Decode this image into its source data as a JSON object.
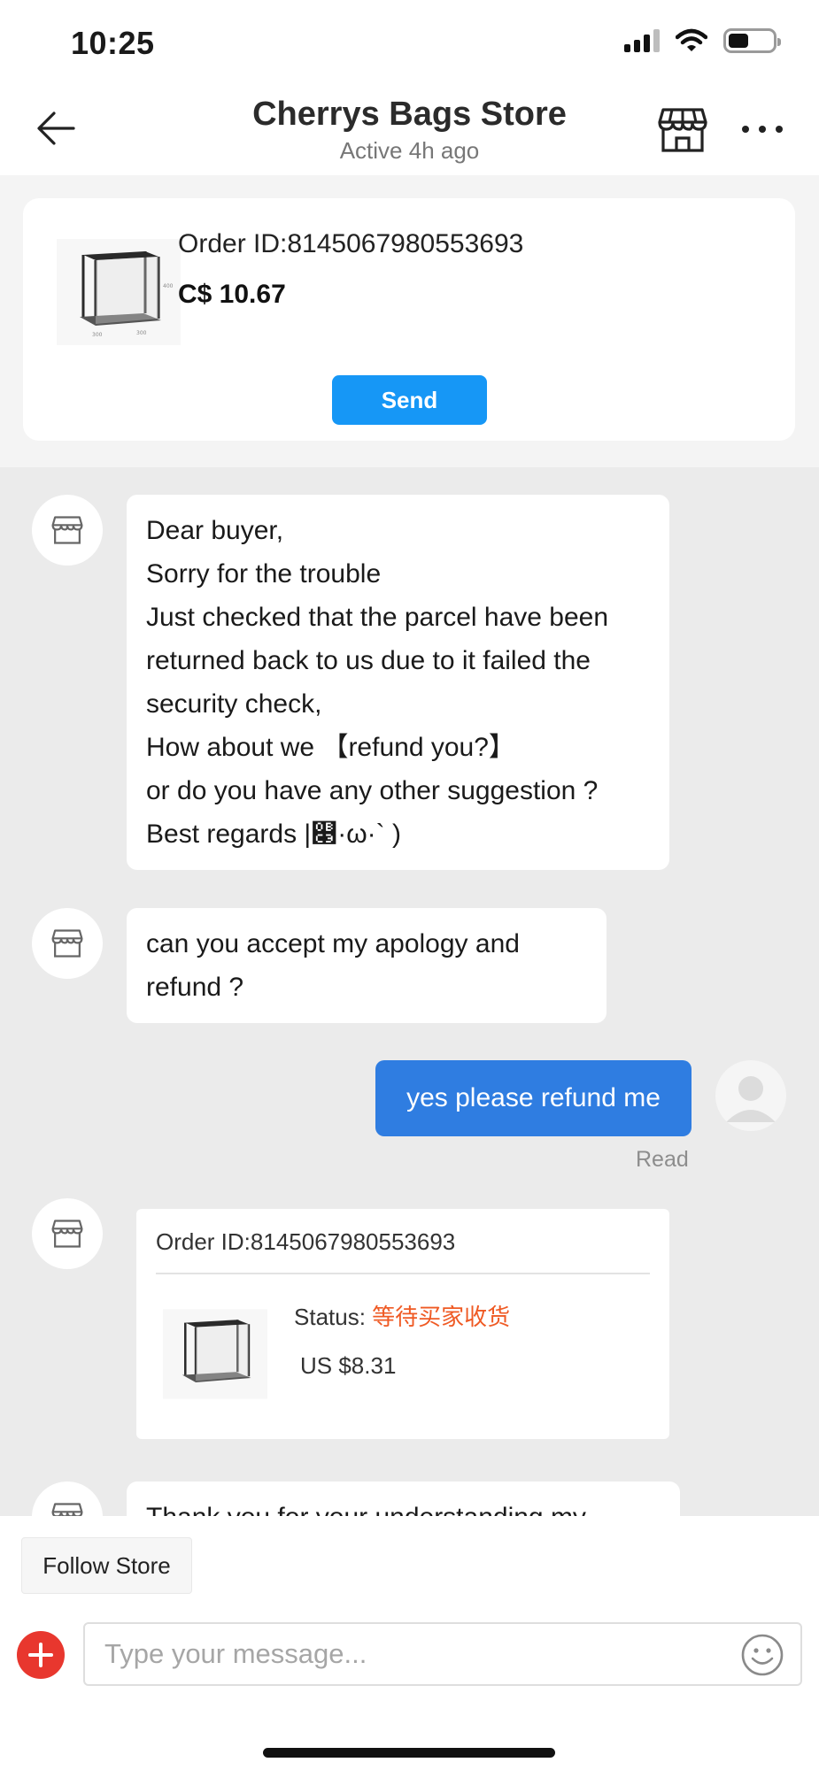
{
  "status_bar": {
    "time": "10:25",
    "signal_icon": "signal-icon",
    "wifi_icon": "wifi-icon",
    "battery_icon": "battery-icon"
  },
  "header": {
    "store_name": "Cherrys Bags Store",
    "active_status": "Active 4h ago",
    "back_icon": "arrow-left-icon",
    "store_icon": "storefront-icon",
    "more_icon": "more-dots-icon"
  },
  "order_card": {
    "order_id": "Order ID:8145067980553693",
    "price": "C$ 10.67",
    "send_label": "Send"
  },
  "messages": {
    "m1_lines": [
      "Dear buyer,",
      "Sorry for the trouble",
      "Just checked that the parcel have been",
      "returned back to us due to it failed the",
      "security check,",
      "How about we 【refund you?】",
      "or do you have any other suggestion ?",
      "Best regards |௃·ω·` )"
    ],
    "m2_lines": [
      "can you  accept  my  apology and",
      "refund ?"
    ],
    "m3_text": "yes please refund me",
    "m3_read": "Read",
    "order_msg": {
      "order_id": "Order ID:8145067980553693",
      "status_label": "Status: ",
      "status_value": "等待买家收货",
      "price": "US $8.31"
    },
    "m5_partial": "Thank you for your understanding my"
  },
  "bottom": {
    "follow_label": "Follow Store",
    "input_placeholder": "Type your message...",
    "plus_icon": "plus-icon",
    "emoji_icon": "emoji-icon"
  },
  "colors": {
    "accent_blue": "#1697f6",
    "outgoing_bubble": "#2f7de1",
    "status_orange": "#ef5a24",
    "plus_red": "#e8372e"
  }
}
